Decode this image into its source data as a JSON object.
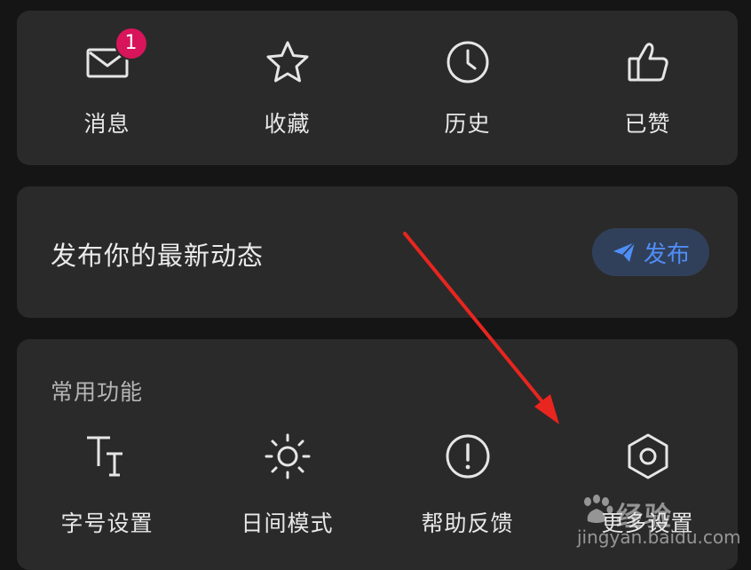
{
  "top_actions": [
    {
      "label": "消息",
      "icon": "mail-icon",
      "badge": "1"
    },
    {
      "label": "收藏",
      "icon": "star-icon"
    },
    {
      "label": "历史",
      "icon": "clock-icon"
    },
    {
      "label": "已赞",
      "icon": "thumbs-up-icon"
    }
  ],
  "post": {
    "prompt": "发布你的最新动态",
    "button_label": "发布",
    "button_icon": "paper-plane-icon"
  },
  "common": {
    "title": "常用功能",
    "items": [
      {
        "label": "字号设置",
        "icon": "font-size-icon"
      },
      {
        "label": "日间模式",
        "icon": "sun-icon"
      },
      {
        "label": "帮助反馈",
        "icon": "exclamation-circle-icon"
      },
      {
        "label": "更多设置",
        "icon": "hexagon-settings-icon"
      }
    ]
  },
  "watermark": {
    "logo_text": "经验",
    "site": "jingyan.baidu.com"
  },
  "colors": {
    "background": "#151515",
    "card": "#2a2a2a",
    "accent_blue": "#4f8ef7",
    "badge": "#d8155a",
    "annotation_arrow": "#e8251f"
  }
}
